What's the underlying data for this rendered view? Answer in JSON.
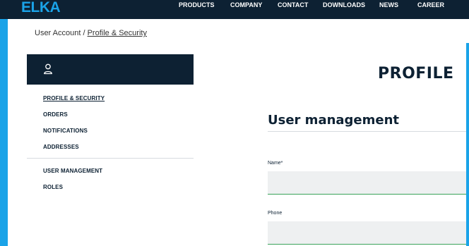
{
  "header": {
    "logo_text": "ELKA",
    "nav": [
      {
        "label": "PRODUCTS"
      },
      {
        "label": "COMPANY"
      },
      {
        "label": "CONTACT"
      },
      {
        "label": "DOWNLOADS"
      },
      {
        "label": "NEWS"
      },
      {
        "label": "CAREER"
      }
    ]
  },
  "breadcrumb": {
    "root": "User Account",
    "separator": " / ",
    "current": "Profile & Security"
  },
  "sidebar": {
    "account_icon": "user-icon",
    "items": [
      {
        "label": "PROFILE & SECURITY",
        "active": true
      },
      {
        "label": "ORDERS",
        "active": false
      },
      {
        "label": "NOTIFICATIONS",
        "active": false
      },
      {
        "label": "ADDRESSES",
        "active": false
      },
      {
        "label": "USER MANAGEMENT",
        "active": false
      },
      {
        "label": "ROLES",
        "active": false
      }
    ]
  },
  "main": {
    "heading": "PROFILE",
    "section_title": "User management",
    "fields": [
      {
        "label": "Name*",
        "value": ""
      },
      {
        "label": "Phone",
        "value": ""
      }
    ]
  },
  "colors": {
    "navy": "#0d2133",
    "accent_blue": "#1aa3e8",
    "input_bg": "#eef0f1",
    "input_underline": "#3aa35a"
  }
}
